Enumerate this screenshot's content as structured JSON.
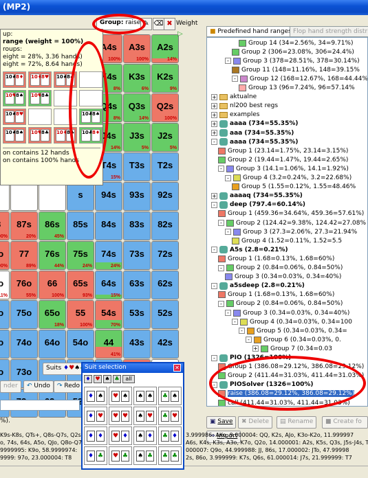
{
  "window": {
    "title": "(MP2)"
  },
  "grid_toolbar": {
    "group_label": "Group:",
    "group_value": "raise",
    "weight_label": "Weight"
  },
  "tooltip": {
    "lines": [
      "up:",
      "range (weight = 100%)",
      "",
      "roups:",
      "eight = 28%, 3.36 hands)",
      "eight = 72%, 8.64 hands)"
    ],
    "combos": [
      {
        "c": "red",
        "cards": [
          "10♠",
          "8♦"
        ]
      },
      {
        "c": "red",
        "cards": [
          "10♦",
          "8♥"
        ]
      },
      {
        "c": "red",
        "cards": [
          "10♠",
          "8♣"
        ]
      },
      {
        "c": "empty",
        "cards": []
      },
      {
        "c": "green",
        "cards": [
          "10♥",
          "8♠"
        ]
      },
      {
        "c": "green",
        "cards": [
          "10♥",
          "8♣"
        ]
      },
      {
        "c": "empty",
        "cards": []
      },
      {
        "c": "empty",
        "cards": []
      },
      {
        "c": "red",
        "cards": [
          "10♠",
          "8♥"
        ]
      },
      {
        "c": "empty",
        "cards": []
      },
      {
        "c": "empty",
        "cards": []
      },
      {
        "c": "green",
        "cards": [
          "10♣",
          "8♠"
        ]
      },
      {
        "c": "red",
        "cards": [
          "10♠",
          "8♠"
        ]
      },
      {
        "c": "red",
        "cards": [
          "10♥",
          "8♣"
        ]
      },
      {
        "c": "red",
        "cards": [
          "10♦",
          "8♣"
        ]
      },
      {
        "c": "green",
        "cards": [
          "10♣",
          "8♦"
        ]
      }
    ],
    "footer1": "on contains 12 hands",
    "footer2": "on contains 100% hands"
  },
  "grid": [
    [
      {
        "l": "A4s",
        "c": "red",
        "p": "100%"
      },
      {
        "l": "A3s",
        "c": "red",
        "p": "100%"
      },
      {
        "l": "A2s",
        "c": "green",
        "p": "14%",
        "f": 0.14,
        "fc": "red"
      }
    ],
    [
      {
        "l": "K4s",
        "c": "green",
        "p": "8%"
      },
      {
        "l": "K3s",
        "c": "green",
        "p": "6%"
      },
      {
        "l": "K2s",
        "c": "green",
        "p": "9%"
      }
    ],
    [
      {
        "l": "Q4s",
        "c": "green",
        "p": "8%"
      },
      {
        "l": "Q3s",
        "c": "green",
        "p": "14%"
      },
      {
        "l": "Q2s",
        "c": "red",
        "p": "100%"
      }
    ],
    [
      {
        "l": "J4s",
        "c": "green",
        "p": "14%"
      },
      {
        "l": "J3s",
        "c": "green",
        "p": "5%"
      },
      {
        "l": "J2s",
        "c": "green",
        "p": "5%"
      }
    ],
    [
      {
        "l": "T4s",
        "c": "blue",
        "p": "15%"
      },
      {
        "l": "T3s",
        "c": "blue",
        "p": ""
      },
      {
        "l": "T2s",
        "c": "blue",
        "p": ""
      }
    ],
    [
      {
        "l": "94s",
        "c": "blue",
        "p": ""
      },
      {
        "l": "93s",
        "c": "blue",
        "p": ""
      },
      {
        "l": "92s",
        "c": "blue",
        "p": ""
      }
    ],
    [
      {
        "l": "84s",
        "c": "blue",
        "p": ""
      },
      {
        "l": "83s",
        "c": "blue",
        "p": ""
      },
      {
        "l": "82s",
        "c": "blue",
        "p": ""
      }
    ],
    [
      {
        "l": "74s",
        "c": "blue",
        "p": "24%",
        "f": 0.24,
        "fc": "green"
      },
      {
        "l": "73s",
        "c": "blue",
        "p": ""
      },
      {
        "l": "72s",
        "c": "blue",
        "p": ""
      }
    ],
    [
      {
        "l": "64s",
        "c": "blue",
        "p": "15%",
        "f": 0.15,
        "fc": "green"
      },
      {
        "l": "63s",
        "c": "blue",
        "p": ""
      },
      {
        "l": "62s",
        "c": "blue",
        "p": ""
      }
    ],
    [
      {
        "l": "54s",
        "c": "red",
        "p": "70%",
        "f": 0.3,
        "fc": "green"
      },
      {
        "l": "53s",
        "c": "blue",
        "p": ""
      },
      {
        "l": "52s",
        "c": "blue",
        "p": ""
      }
    ],
    [
      {
        "l": "44",
        "c": "green",
        "p": "41%",
        "f": 0.41,
        "fc": "red"
      },
      {
        "l": "43s",
        "c": "blue",
        "p": ""
      },
      {
        "l": "42s",
        "c": "blue",
        "p": ""
      }
    ],
    [
      {
        "l": "43o",
        "c": "blue",
        "p": ""
      },
      {
        "l": "33",
        "c": "red",
        "p": "100%"
      },
      {
        "l": "32s",
        "c": "white",
        "p": "11%"
      }
    ],
    [
      {
        "l": "42o",
        "c": "blue",
        "p": ""
      },
      {
        "l": "32o",
        "c": "blue",
        "p": ""
      },
      {
        "l": "22",
        "c": "red",
        "p": "93%",
        "f": 0.07,
        "fc": "green"
      }
    ]
  ],
  "grid_left": [
    [
      {
        "l": "",
        "c": "white",
        "p": ""
      },
      {
        "l": "",
        "c": "white",
        "p": ""
      },
      {
        "l": "",
        "c": "white",
        "p": ""
      },
      {
        "l": "s",
        "c": "green",
        "p": ""
      }
    ],
    [
      {
        "l": "",
        "c": "white",
        "p": ""
      },
      {
        "l": "",
        "c": "white",
        "p": ""
      },
      {
        "l": "",
        "c": "white",
        "p": ""
      },
      {
        "l": "s",
        "c": "green",
        "p": ""
      }
    ],
    [
      {
        "l": "",
        "c": "white",
        "p": ""
      },
      {
        "l": "",
        "c": "white",
        "p": ""
      },
      {
        "l": "",
        "c": "white",
        "p": ""
      },
      {
        "l": "s",
        "c": "green",
        "p": ""
      }
    ],
    [
      {
        "l": "",
        "c": "white",
        "p": ""
      },
      {
        "l": "",
        "c": "white",
        "p": ""
      },
      {
        "l": "",
        "c": "white",
        "p": ""
      },
      {
        "l": "s",
        "c": "green",
        "p": ""
      }
    ],
    [
      {
        "l": "",
        "c": "white",
        "p": ""
      },
      {
        "l": "",
        "c": "white",
        "p": ""
      },
      {
        "l": "",
        "c": "white",
        "p": ""
      },
      {
        "l": "s",
        "c": "green",
        "p": ""
      }
    ],
    [
      {
        "l": "",
        "c": "white",
        "p": ""
      },
      {
        "l": "",
        "c": "white",
        "p": ""
      },
      {
        "l": "",
        "c": "white",
        "p": ""
      },
      {
        "l": "s",
        "c": "blue",
        "p": ""
      }
    ],
    [
      {
        "l": "88",
        "c": "red",
        "p": "100%"
      },
      {
        "l": "87s",
        "c": "red",
        "p": "20%"
      },
      {
        "l": "86s",
        "c": "green",
        "p": "45%"
      },
      {
        "l": "85s",
        "c": "blue",
        "p": ""
      }
    ],
    [
      {
        "l": "87o",
        "c": "red",
        "p": "100%"
      },
      {
        "l": "77",
        "c": "red",
        "p": "89%"
      },
      {
        "l": "76s",
        "c": "green",
        "p": "44%"
      },
      {
        "l": "75s",
        "c": "green",
        "p": "24%"
      }
    ],
    [
      {
        "l": "86o",
        "c": "white",
        "p": "11%"
      },
      {
        "l": "76o",
        "c": "red",
        "p": "55%"
      },
      {
        "l": "66",
        "c": "red",
        "p": "100%"
      },
      {
        "l": "65s",
        "c": "red",
        "p": "93%"
      }
    ],
    [
      {
        "l": "85o",
        "c": "blue",
        "p": ""
      },
      {
        "l": "75o",
        "c": "blue",
        "p": ""
      },
      {
        "l": "65o",
        "c": "green",
        "p": "18%"
      },
      {
        "l": "55",
        "c": "red",
        "p": "100%"
      }
    ],
    [
      {
        "l": "84o",
        "c": "blue",
        "p": ""
      },
      {
        "l": "74o",
        "c": "blue",
        "p": ""
      },
      {
        "l": "64o",
        "c": "blue",
        "p": ""
      },
      {
        "l": "54o",
        "c": "blue",
        "p": ""
      }
    ],
    [
      {
        "l": "83o",
        "c": "blue",
        "p": ""
      },
      {
        "l": "73o",
        "c": "blue",
        "p": ""
      },
      {
        "l": "63o",
        "c": "blue",
        "p": ""
      },
      {
        "l": "53o",
        "c": "blue",
        "p": ""
      }
    ],
    [
      {
        "l": "82o",
        "c": "blue",
        "p": ""
      },
      {
        "l": "72o",
        "c": "blue",
        "p": ""
      },
      {
        "l": "62o",
        "c": "blue",
        "p": ""
      },
      {
        "l": "52o",
        "c": "blue",
        "p": ""
      }
    ]
  ],
  "right_tabs": {
    "tab1": "Predefined hand ranges",
    "tab2": "Flop hand strength distrib"
  },
  "tree": [
    {
      "indent": 5,
      "type": "swatch",
      "color": "#66cc66",
      "text": "Group 14 (34=2.56%, 34=9.71%)"
    },
    {
      "indent": 4,
      "type": "swatch",
      "color": "#66cc66",
      "text": "Group 2 (306=23.08%, 306=24.4%)"
    },
    {
      "indent": 3,
      "type": "swatch",
      "color": "#8888ee",
      "exp": "-",
      "text": "Group 3 (378=28.51%, 378=30.14%)"
    },
    {
      "indent": 4,
      "type": "swatch",
      "color": "#aa7722",
      "text": "Group 11 (148=11.16%, 148=39.15%"
    },
    {
      "indent": 4,
      "type": "swatch",
      "color": "#cc88cc",
      "exp": "-",
      "text": "Group 12 (168=12.67%, 168=44.44%"
    },
    {
      "indent": 5,
      "type": "swatch",
      "color": "#ffaaaa",
      "text": "Group 13 (96=7.24%, 96=57.14%"
    },
    {
      "indent": 1,
      "type": "folder",
      "exp": "+",
      "text": "aktualne"
    },
    {
      "indent": 1,
      "type": "folder",
      "exp": "+",
      "text": "nl200 best regs"
    },
    {
      "indent": 1,
      "type": "folder",
      "exp": "+",
      "text": "examples"
    },
    {
      "indent": 1,
      "type": "hicon",
      "exp": "+",
      "text": "aaaa (734=55.35%)",
      "bold": true
    },
    {
      "indent": 1,
      "type": "hicon",
      "exp": "+",
      "text": "aaa (734=55.35%)",
      "bold": true
    },
    {
      "indent": 1,
      "type": "hicon",
      "exp": "-",
      "text": "aaaa (734=55.35%)",
      "bold": true
    },
    {
      "indent": 2,
      "type": "swatch",
      "color": "#ee7766",
      "text": "Group 1 (23.14=1.75%, 23.14=3.15%)"
    },
    {
      "indent": 2,
      "type": "swatch",
      "color": "#66cc66",
      "text": "Group 2 (19.44=1.47%, 19.44=2.65%)"
    },
    {
      "indent": 2,
      "type": "swatch",
      "color": "#8888ee",
      "exp": "-",
      "text": "Group 3 (14.1=1.06%, 14.1=1.92%)"
    },
    {
      "indent": 3,
      "type": "swatch",
      "color": "#dddd55",
      "exp": "-",
      "text": "Group 4 (3.2=0.24%, 3.2=22.68%)"
    },
    {
      "indent": 4,
      "type": "swatch",
      "color": "#e8a020",
      "text": "Group 5 (1.55=0.12%, 1.55=48.46%"
    },
    {
      "indent": 1,
      "type": "hicon",
      "exp": "+",
      "text": "aaaaq (734=55.35%)",
      "bold": true
    },
    {
      "indent": 1,
      "type": "hicon",
      "exp": "-",
      "text": "deep (797.4=60.14%)",
      "bold": true
    },
    {
      "indent": 2,
      "type": "swatch",
      "color": "#ee7766",
      "text": "Group 1 (459.36=34.64%, 459.36=57.61%)"
    },
    {
      "indent": 2,
      "type": "swatch",
      "color": "#66cc66",
      "exp": "-",
      "text": "Group 2 (124.42=9.38%, 124.42=27.08%"
    },
    {
      "indent": 3,
      "type": "swatch",
      "color": "#8888ee",
      "exp": "-",
      "text": "Group 3 (27.3=2.06%, 27.3=21.94%"
    },
    {
      "indent": 4,
      "type": "swatch",
      "color": "#dddd55",
      "text": "Group 4 (1.52=0.11%, 1.52=5.5"
    },
    {
      "indent": 1,
      "type": "hicon",
      "exp": "-",
      "text": "A5s (2.8=0.21%)",
      "bold": true
    },
    {
      "indent": 2,
      "type": "swatch",
      "color": "#ee7766",
      "text": "Group 1 (1.68=0.13%, 1.68=60%)"
    },
    {
      "indent": 2,
      "type": "swatch",
      "color": "#66cc66",
      "exp": "-",
      "text": "Group 2 (0.84=0.06%, 0.84=50%)"
    },
    {
      "indent": 3,
      "type": "swatch",
      "color": "#8888ee",
      "text": "Group 3 (0.34=0.03%, 0.34=40%)"
    },
    {
      "indent": 1,
      "type": "hicon",
      "exp": "-",
      "text": "a5sdeep (2.8=0.21%)",
      "bold": true
    },
    {
      "indent": 2,
      "type": "swatch",
      "color": "#ee7766",
      "text": "Group 1 (1.68=0.13%, 1.68=60%)"
    },
    {
      "indent": 2,
      "type": "swatch",
      "color": "#66cc66",
      "exp": "-",
      "text": "Group 2 (0.84=0.06%, 0.84=50%)"
    },
    {
      "indent": 3,
      "type": "swatch",
      "color": "#8888ee",
      "exp": "-",
      "text": "Group 3 (0.34=0.03%, 0.34=40%)"
    },
    {
      "indent": 4,
      "type": "swatch",
      "color": "#dddd55",
      "exp": "-",
      "text": "Group 4 (0.34=0.03%, 0.34=100"
    },
    {
      "indent": 5,
      "type": "swatch",
      "color": "#e8a020",
      "exp": "-",
      "text": "Group 5 (0.34=0.03%, 0.34="
    },
    {
      "indent": 6,
      "type": "swatch",
      "color": "#e8a020",
      "exp": "-",
      "text": "Group 6 (0.34=0.03%, 0."
    },
    {
      "indent": 7,
      "type": "swatch",
      "color": "#66cc66",
      "exp": "+",
      "text": "Group 7 (0.34=0.03"
    },
    {
      "indent": 1,
      "type": "hicon",
      "exp": "-",
      "text": "PIO (1326=100%)",
      "bold": true
    },
    {
      "indent": 2,
      "type": "swatch",
      "color": "#ee7766",
      "text": "Group 1 (386.08=29.12%, 386.08=29.12%)"
    },
    {
      "indent": 2,
      "type": "swatch",
      "color": "#66cc66",
      "text": "Group 2 (411.44=31.03%, 411.44=31.03%)"
    },
    {
      "indent": 1,
      "type": "hicon",
      "exp": "-",
      "text": "PIOSolver (1326=100%)",
      "bold": true
    },
    {
      "indent": 2,
      "type": "swatch",
      "color": "#ee7766",
      "text": "raise (386.08=29.12%, 386.08=29.12%)",
      "selected": true
    },
    {
      "indent": 2,
      "type": "swatch",
      "color": "#66cc66",
      "text": "call (411.44=31.03%, 411.44=31.03%)"
    }
  ],
  "right_buttons": {
    "save": "Save",
    "delete": "Delete",
    "rename": "Rename",
    "create": "Create fo",
    "import": "Import"
  },
  "bottom_left": {
    "suits_btn": "Suits",
    "nder": "nder",
    "undo": "Undo",
    "redo": "Redo",
    "pct_text": "%)."
  },
  "suit_selection": {
    "title": "Suit selection",
    "all": "all",
    "rows": [
      [
        [
          "♦",
          "♠"
        ],
        [
          "♥",
          "♠"
        ],
        [
          "♠",
          "♠"
        ],
        [
          "♣",
          "♠"
        ]
      ],
      [
        [
          "♦",
          "♥"
        ],
        [
          "♥",
          "♥"
        ],
        [
          "♠",
          "♥"
        ],
        [
          "♣",
          "♥"
        ]
      ],
      [
        [
          "♦",
          "♦"
        ],
        [
          "♥",
          "♦"
        ],
        [
          "♠",
          "♦"
        ],
        [
          "♣",
          "♦"
        ]
      ],
      [
        [
          "♦",
          "♣"
        ],
        [
          "♥",
          "♣"
        ],
        [
          "♠",
          "♣"
        ],
        [
          "♣",
          "♣"
        ]
      ]
    ]
  },
  "text_lines": [
    "K9s-K8s, QTs+, Q8s-Q7s, Q2s,",
    "o, 74s, 64s, A5o, QJo, Q8o-Q7c",
    "9999995: K9o, 58.9999974:",
    "9999: 97o, 23.000004: T8",
    "3.999986: AKo, 9.000004: QQ, K2s, AJo, K3o-K2o, 11.999997",
    "A6s, K4s, K3s, A3o, K7o, Q2o, 14.000001: A2s, K5s, Q3s, J5s-J4s, T5s",
    "000007: Q9o, 44.999988: JJ, 86s, 17.000002: JTo, 47.99998",
    "2s, 86o, 3.999999: K7s, Q6s, 61.000014: J7s, 21.999999: T7"
  ]
}
